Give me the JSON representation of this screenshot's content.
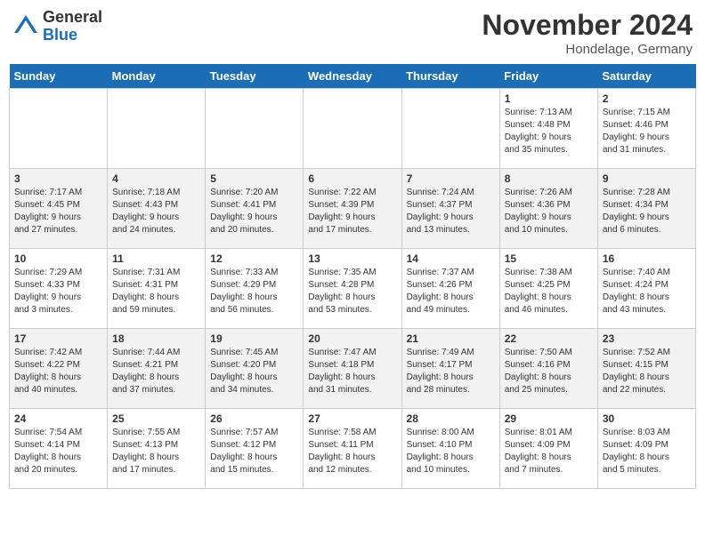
{
  "header": {
    "logo_general": "General",
    "logo_blue": "Blue",
    "month_title": "November 2024",
    "location": "Hondelage, Germany"
  },
  "weekdays": [
    "Sunday",
    "Monday",
    "Tuesday",
    "Wednesday",
    "Thursday",
    "Friday",
    "Saturday"
  ],
  "weeks": [
    [
      {
        "day": "",
        "info": ""
      },
      {
        "day": "",
        "info": ""
      },
      {
        "day": "",
        "info": ""
      },
      {
        "day": "",
        "info": ""
      },
      {
        "day": "",
        "info": ""
      },
      {
        "day": "1",
        "info": "Sunrise: 7:13 AM\nSunset: 4:48 PM\nDaylight: 9 hours\nand 35 minutes."
      },
      {
        "day": "2",
        "info": "Sunrise: 7:15 AM\nSunset: 4:46 PM\nDaylight: 9 hours\nand 31 minutes."
      }
    ],
    [
      {
        "day": "3",
        "info": "Sunrise: 7:17 AM\nSunset: 4:45 PM\nDaylight: 9 hours\nand 27 minutes."
      },
      {
        "day": "4",
        "info": "Sunrise: 7:18 AM\nSunset: 4:43 PM\nDaylight: 9 hours\nand 24 minutes."
      },
      {
        "day": "5",
        "info": "Sunrise: 7:20 AM\nSunset: 4:41 PM\nDaylight: 9 hours\nand 20 minutes."
      },
      {
        "day": "6",
        "info": "Sunrise: 7:22 AM\nSunset: 4:39 PM\nDaylight: 9 hours\nand 17 minutes."
      },
      {
        "day": "7",
        "info": "Sunrise: 7:24 AM\nSunset: 4:37 PM\nDaylight: 9 hours\nand 13 minutes."
      },
      {
        "day": "8",
        "info": "Sunrise: 7:26 AM\nSunset: 4:36 PM\nDaylight: 9 hours\nand 10 minutes."
      },
      {
        "day": "9",
        "info": "Sunrise: 7:28 AM\nSunset: 4:34 PM\nDaylight: 9 hours\nand 6 minutes."
      }
    ],
    [
      {
        "day": "10",
        "info": "Sunrise: 7:29 AM\nSunset: 4:33 PM\nDaylight: 9 hours\nand 3 minutes."
      },
      {
        "day": "11",
        "info": "Sunrise: 7:31 AM\nSunset: 4:31 PM\nDaylight: 8 hours\nand 59 minutes."
      },
      {
        "day": "12",
        "info": "Sunrise: 7:33 AM\nSunset: 4:29 PM\nDaylight: 8 hours\nand 56 minutes."
      },
      {
        "day": "13",
        "info": "Sunrise: 7:35 AM\nSunset: 4:28 PM\nDaylight: 8 hours\nand 53 minutes."
      },
      {
        "day": "14",
        "info": "Sunrise: 7:37 AM\nSunset: 4:26 PM\nDaylight: 8 hours\nand 49 minutes."
      },
      {
        "day": "15",
        "info": "Sunrise: 7:38 AM\nSunset: 4:25 PM\nDaylight: 8 hours\nand 46 minutes."
      },
      {
        "day": "16",
        "info": "Sunrise: 7:40 AM\nSunset: 4:24 PM\nDaylight: 8 hours\nand 43 minutes."
      }
    ],
    [
      {
        "day": "17",
        "info": "Sunrise: 7:42 AM\nSunset: 4:22 PM\nDaylight: 8 hours\nand 40 minutes."
      },
      {
        "day": "18",
        "info": "Sunrise: 7:44 AM\nSunset: 4:21 PM\nDaylight: 8 hours\nand 37 minutes."
      },
      {
        "day": "19",
        "info": "Sunrise: 7:45 AM\nSunset: 4:20 PM\nDaylight: 8 hours\nand 34 minutes."
      },
      {
        "day": "20",
        "info": "Sunrise: 7:47 AM\nSunset: 4:18 PM\nDaylight: 8 hours\nand 31 minutes."
      },
      {
        "day": "21",
        "info": "Sunrise: 7:49 AM\nSunset: 4:17 PM\nDaylight: 8 hours\nand 28 minutes."
      },
      {
        "day": "22",
        "info": "Sunrise: 7:50 AM\nSunset: 4:16 PM\nDaylight: 8 hours\nand 25 minutes."
      },
      {
        "day": "23",
        "info": "Sunrise: 7:52 AM\nSunset: 4:15 PM\nDaylight: 8 hours\nand 22 minutes."
      }
    ],
    [
      {
        "day": "24",
        "info": "Sunrise: 7:54 AM\nSunset: 4:14 PM\nDaylight: 8 hours\nand 20 minutes."
      },
      {
        "day": "25",
        "info": "Sunrise: 7:55 AM\nSunset: 4:13 PM\nDaylight: 8 hours\nand 17 minutes."
      },
      {
        "day": "26",
        "info": "Sunrise: 7:57 AM\nSunset: 4:12 PM\nDaylight: 8 hours\nand 15 minutes."
      },
      {
        "day": "27",
        "info": "Sunrise: 7:58 AM\nSunset: 4:11 PM\nDaylight: 8 hours\nand 12 minutes."
      },
      {
        "day": "28",
        "info": "Sunrise: 8:00 AM\nSunset: 4:10 PM\nDaylight: 8 hours\nand 10 minutes."
      },
      {
        "day": "29",
        "info": "Sunrise: 8:01 AM\nSunset: 4:09 PM\nDaylight: 8 hours\nand 7 minutes."
      },
      {
        "day": "30",
        "info": "Sunrise: 8:03 AM\nSunset: 4:09 PM\nDaylight: 8 hours\nand 5 minutes."
      }
    ]
  ]
}
